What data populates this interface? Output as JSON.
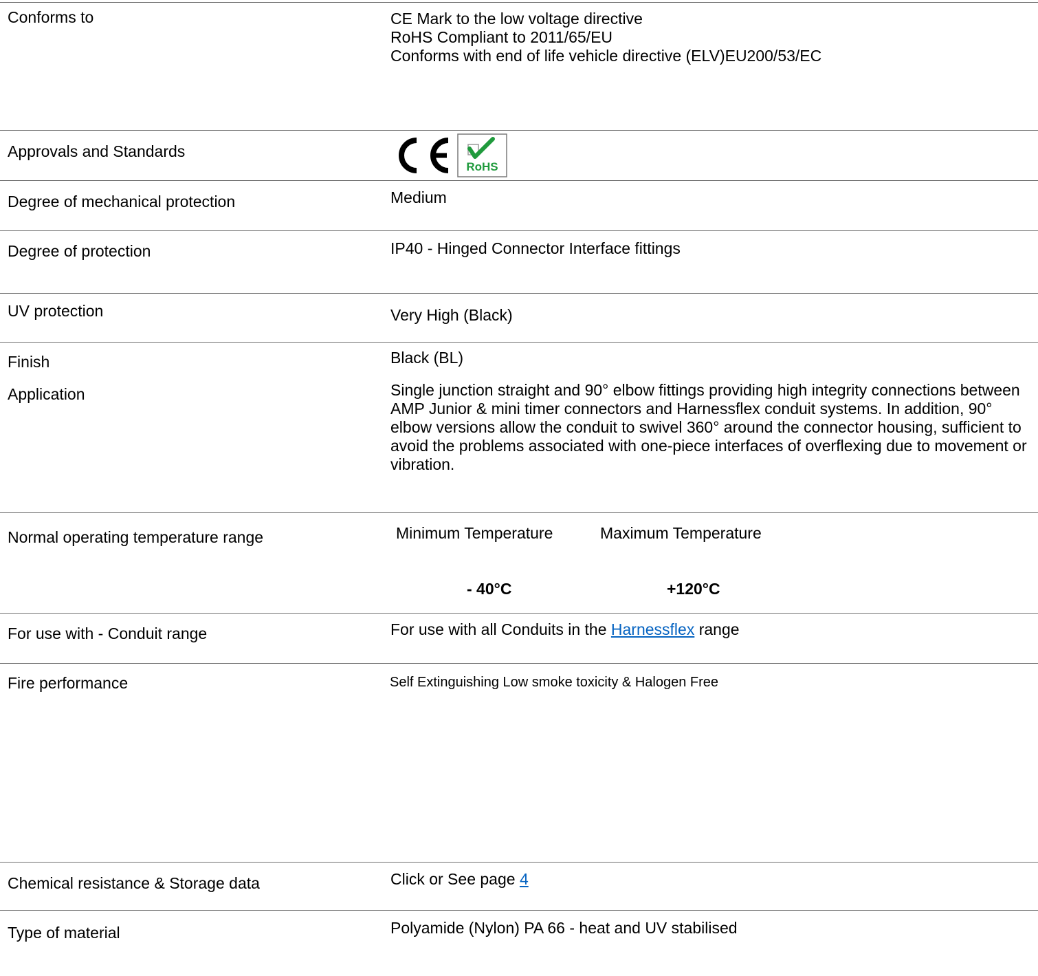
{
  "rows": [
    {
      "label": "Conforms to",
      "lines": [
        "CE Mark to the low voltage directive",
        "RoHS Compliant to 2011/65/EU",
        "Conforms with end of life vehicle directive (ELV)EU200/53/EC"
      ]
    },
    {
      "label": "Approvals and Standards",
      "icons": [
        "ce-mark-icon",
        "rohs-mark-icon"
      ],
      "rohs_text": "RoHS"
    },
    {
      "label": "Degree of mechanical protection",
      "value": "Medium"
    },
    {
      "label": "Degree of protection",
      "value": "IP40 - Hinged Connector Interface fittings"
    },
    {
      "label": "UV protection",
      "value": "Very High (Black)"
    },
    {
      "label": "Finish",
      "value": "Black (BL)"
    },
    {
      "label": "Application",
      "value": "Single junction straight and 90° elbow fittings providing high integrity connections between AMP Junior & mini timer connectors and Harnessflex conduit systems. In addition, 90° elbow versions allow the conduit to swivel 360° around the connector housing, sufficient to avoid the problems associated with one-piece interfaces of overflexing due to movement or vibration."
    },
    {
      "label": "Normal operating temperature range",
      "min_heading": "Minimum Temperature",
      "max_heading": "Maximum Temperature",
      "min_value": "- 40°C",
      "max_value": "+120°C"
    },
    {
      "label": "For use with - Conduit  range",
      "prefix": "For use with all Conduits in the ",
      "link": "Harnessflex",
      "suffix": " range"
    },
    {
      "label": "Fire performance",
      "value": "Self Extinguishing Low smoke toxicity & Halogen Free"
    },
    {
      "label": "Chemical resistance & Storage data",
      "prefix": "Click or See page ",
      "link": "4"
    },
    {
      "label": "Type of material",
      "value": "Polyamide (Nylon) PA 66 - heat and UV stabilised"
    }
  ],
  "colors": {
    "rule": "#6e6e6e",
    "link": "#0563c1",
    "rohs_green": "#1f9a3c"
  }
}
